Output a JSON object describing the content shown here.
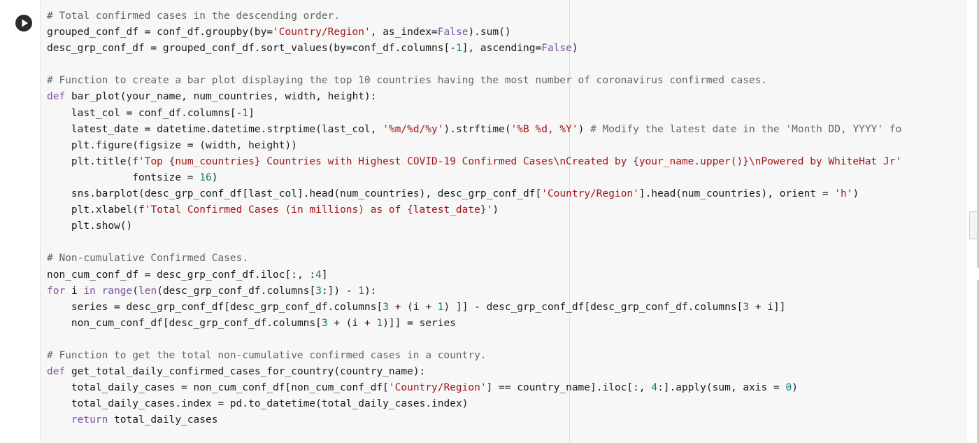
{
  "cell": {
    "run_button_icon": "play-icon",
    "code_lines": [
      "# Total confirmed cases in the descending order.",
      "grouped_conf_df = conf_df.groupby(by='Country/Region', as_index=False).sum()",
      "desc_grp_conf_df = grouped_conf_df.sort_values(by=conf_df.columns[-1], ascending=False)",
      "",
      "# Function to create a bar plot displaying the top 10 countries having the most number of coronavirus confirmed cases.",
      "def bar_plot(your_name, num_countries, width, height):",
      "    last_col = conf_df.columns[-1]",
      "    latest_date = datetime.datetime.strptime(last_col, '%m/%d/%y').strftime('%B %d, %Y') # Modify the latest date in the 'Month DD, YYYY' fo",
      "    plt.figure(figsize = (width, height))",
      "    plt.title(f'Top {num_countries} Countries with Highest COVID-19 Confirmed Cases\\nCreated by {your_name.upper()}\\nPowered by WhiteHat Jr'",
      "              fontsize = 16)",
      "    sns.barplot(desc_grp_conf_df[last_col].head(num_countries), desc_grp_conf_df['Country/Region'].head(num_countries), orient = 'h')",
      "    plt.xlabel(f'Total Confirmed Cases (in millions) as of {latest_date}')",
      "    plt.show()",
      "",
      "# Non-cumulative Confirmed Cases.",
      "non_cum_conf_df = desc_grp_conf_df.iloc[:, :4]",
      "for i in range(len(desc_grp_conf_df.columns[3:]) - 1):",
      "    series = desc_grp_conf_df[desc_grp_conf_df.columns[3 + (i + 1) ]] - desc_grp_conf_df[desc_grp_conf_df.columns[3 + i]]",
      "    non_cum_conf_df[desc_grp_conf_df.columns[3 + (i + 1)]] = series",
      "",
      "# Function to get the total non-cumulative confirmed cases in a country.",
      "def get_total_daily_confirmed_cases_for_country(country_name):",
      "    total_daily_cases = non_cum_conf_df[non_cum_conf_df['Country/Region'] == country_name].iloc[:, 4:].apply(sum, axis = 0)",
      "    total_daily_cases.index = pd.to_datetime(total_daily_cases.index)",
      "    return total_daily_cases"
    ]
  },
  "colors": {
    "keyword": "#7a4fa0",
    "string": "#a31515",
    "comment": "#5b6b5b",
    "number": "#0b7a75",
    "text": "#1a1a1a"
  }
}
